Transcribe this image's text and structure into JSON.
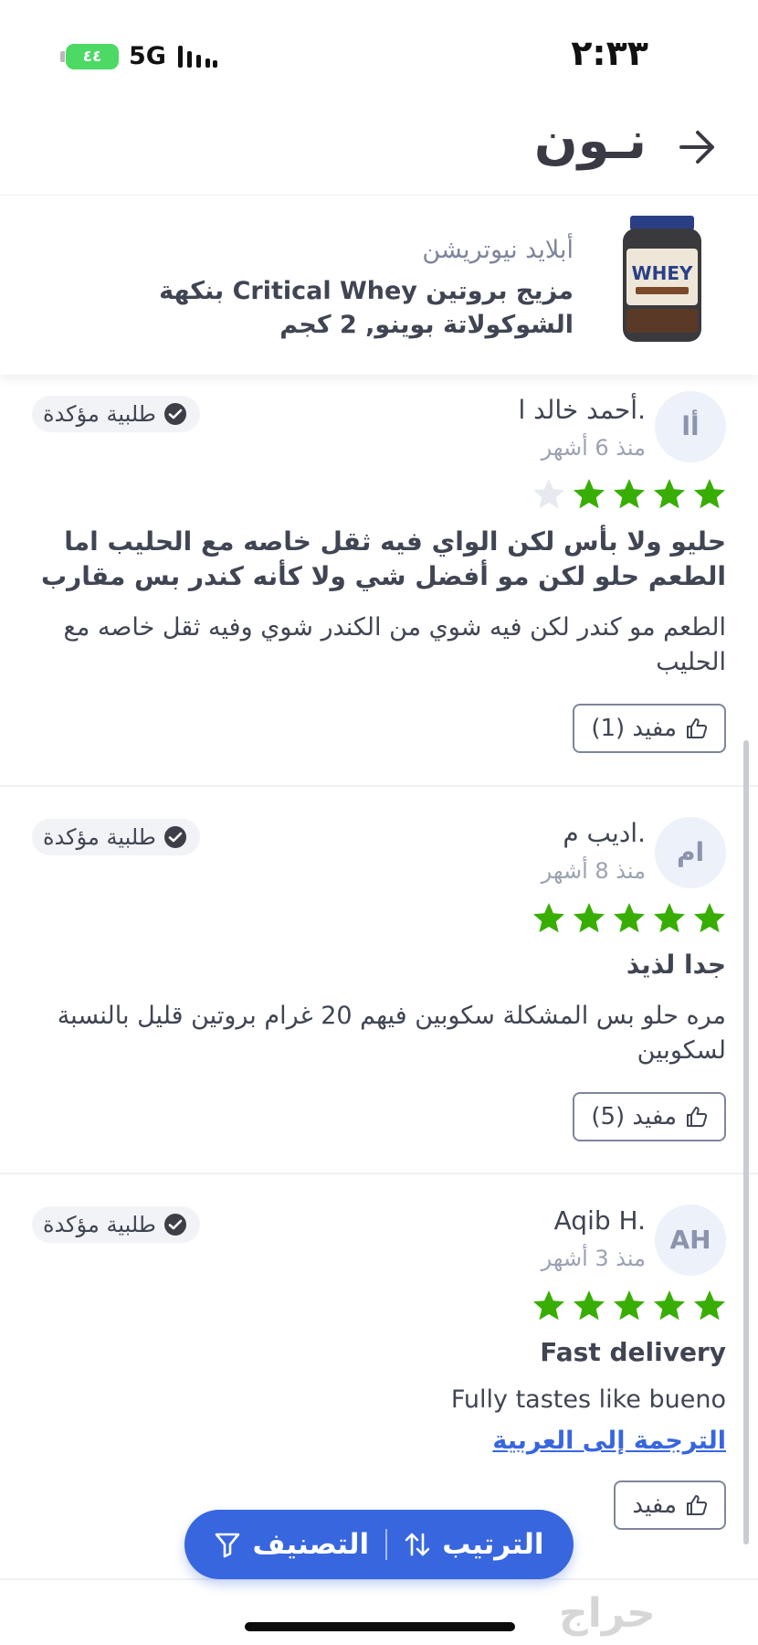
{
  "status_bar": {
    "time": "٢:٣٣",
    "battery": "٤٤",
    "network": "5G"
  },
  "header": {
    "logo_text": "نـون",
    "back_icon": "arrow-right-icon"
  },
  "product": {
    "brand": "أبلايد نيوتريشن",
    "title": "مزيج بروتين Critical Whey بنكهة الشوكولاتة بوينو, 2 كجم",
    "thumbnail_label": "WHEY"
  },
  "reviews": [
    {
      "avatar": "أا",
      "name": "أحمد خالد ا.",
      "date": "منذ 6 أشهر",
      "verified": "طلبية مؤكدة",
      "rating": 4,
      "title": "حليو ولا بأس لكن الواي فيه ثقل خاصه مع الحليب اما الطعم حلو لكن مو أفضل شي ولا كأنه كندر بس مقارب",
      "body": "الطعم مو كندر لكن فيه شوي من الكندر شوي وفيه ثقل خاصه مع الحليب",
      "helpful": "مفيد (1)"
    },
    {
      "avatar": "ام",
      "name": "اديب م.",
      "date": "منذ 8 أشهر",
      "verified": "طلبية مؤكدة",
      "rating": 5,
      "title": "جدا لذيذ",
      "body": "مره حلو بس المشكلة سكوبين فيهم 20 غرام بروتين قليل بالنسبة لسكوبين",
      "helpful": "مفيد (5)"
    },
    {
      "avatar": "AH",
      "name": "Aqib H.",
      "date": "منذ 3 أشهر",
      "verified": "طلبية مؤكدة",
      "rating": 5,
      "title": "Fast delivery",
      "body": "Fully tastes like bueno",
      "translate": "الترجمة إلى العربية",
      "helpful": "مفيد"
    }
  ],
  "bottom_actions": {
    "sort": "الترتيب",
    "filter": "التصنيف"
  },
  "watermark": "حراج",
  "colors": {
    "accent": "#3866df",
    "star": "#38ae04",
    "star_empty": "#e6e9ef",
    "text": "#404553"
  }
}
